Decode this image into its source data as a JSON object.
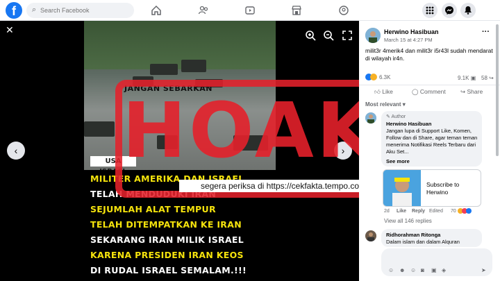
{
  "topbar": {
    "logo": "f",
    "search_placeholder": "Search Facebook",
    "nav_icons": [
      "home-icon",
      "friends-icon",
      "watch-icon",
      "marketplace-icon",
      "groups-icon"
    ],
    "right_icons": [
      "menu-icon",
      "messenger-icon",
      "notifications-icon"
    ]
  },
  "viewer": {
    "close_label": "✕",
    "prev_label": "‹",
    "next_label": "›",
    "jangan_text": "JANGAN SEBARKAN",
    "usa_tag": "USA ISRAEL",
    "caption_lines": [
      {
        "text": "MILITER AMERIKA DAN ISRAEL",
        "color": "yellow"
      },
      {
        "text": "TELAH MENDUDUKI IRAN",
        "color": "white"
      },
      {
        "text": "SEJUMLAH ALAT TEMPUR",
        "color": "yellow"
      },
      {
        "text": "TELAH DITEMPATKAN KE IRAN",
        "color": "yellow"
      },
      {
        "text": "SEKARANG IRAN MILIK ISRAEL",
        "color": "white"
      },
      {
        "text": "KARENA PRESIDEN IRAN KEOS",
        "color": "yellow"
      },
      {
        "text": "DI RUDAL ISRAEL SEMALAM.!!!",
        "color": "white"
      }
    ]
  },
  "stamp": {
    "word": "HOAKS",
    "subtitle": "segera periksa di https://cekfakta.tempo.co",
    "color": "#e4212b"
  },
  "post": {
    "author": "Herwino Hasibuan",
    "time": "March 15 at 4:27 PM",
    "text": "milit3r 4merik4 dan milit3r i5r43l sudah mendarat di wilayah ir4n.",
    "reactions_count": "6.3K",
    "comments_count": "9.1K",
    "shares_count": "58",
    "actions": {
      "like": "Like",
      "comment": "Comment",
      "share": "Share"
    },
    "sort_label": "Most relevant",
    "comments": [
      {
        "badge": "Author",
        "author": "Herwino Hasibuan",
        "text": "Jangan lupa di Support Like, Komen, Follow dan di Share, agar teman teman menerima Notifikasi Reels Terbaru dari Aku Set...",
        "see_more": "See more",
        "meta": {
          "time": "2d",
          "like": "Like",
          "reply": "Reply",
          "edited": "Edited",
          "react_count": "70"
        }
      },
      {
        "author": "Ridhorahman Ritonga",
        "text": "Dalam islam dan dalam Alquran"
      }
    ],
    "subscribe_text": "Subscribe to Herwino",
    "view_all": "View all 146 replies"
  },
  "colors": {
    "brand": "#1877f2",
    "caption_yellow": "#f5e30c",
    "stamp_red": "#e4212b"
  }
}
